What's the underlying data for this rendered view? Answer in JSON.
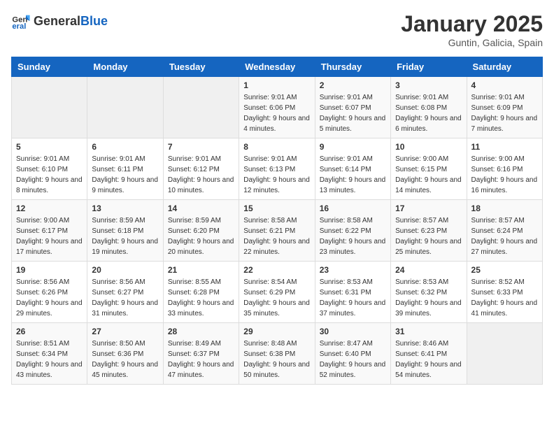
{
  "header": {
    "logo_general": "General",
    "logo_blue": "Blue",
    "month": "January 2025",
    "location": "Guntin, Galicia, Spain"
  },
  "days_of_week": [
    "Sunday",
    "Monday",
    "Tuesday",
    "Wednesday",
    "Thursday",
    "Friday",
    "Saturday"
  ],
  "weeks": [
    [
      {
        "day": "",
        "info": ""
      },
      {
        "day": "",
        "info": ""
      },
      {
        "day": "",
        "info": ""
      },
      {
        "day": "1",
        "info": "Sunrise: 9:01 AM\nSunset: 6:06 PM\nDaylight: 9 hours and 4 minutes."
      },
      {
        "day": "2",
        "info": "Sunrise: 9:01 AM\nSunset: 6:07 PM\nDaylight: 9 hours and 5 minutes."
      },
      {
        "day": "3",
        "info": "Sunrise: 9:01 AM\nSunset: 6:08 PM\nDaylight: 9 hours and 6 minutes."
      },
      {
        "day": "4",
        "info": "Sunrise: 9:01 AM\nSunset: 6:09 PM\nDaylight: 9 hours and 7 minutes."
      }
    ],
    [
      {
        "day": "5",
        "info": "Sunrise: 9:01 AM\nSunset: 6:10 PM\nDaylight: 9 hours and 8 minutes."
      },
      {
        "day": "6",
        "info": "Sunrise: 9:01 AM\nSunset: 6:11 PM\nDaylight: 9 hours and 9 minutes."
      },
      {
        "day": "7",
        "info": "Sunrise: 9:01 AM\nSunset: 6:12 PM\nDaylight: 9 hours and 10 minutes."
      },
      {
        "day": "8",
        "info": "Sunrise: 9:01 AM\nSunset: 6:13 PM\nDaylight: 9 hours and 12 minutes."
      },
      {
        "day": "9",
        "info": "Sunrise: 9:01 AM\nSunset: 6:14 PM\nDaylight: 9 hours and 13 minutes."
      },
      {
        "day": "10",
        "info": "Sunrise: 9:00 AM\nSunset: 6:15 PM\nDaylight: 9 hours and 14 minutes."
      },
      {
        "day": "11",
        "info": "Sunrise: 9:00 AM\nSunset: 6:16 PM\nDaylight: 9 hours and 16 minutes."
      }
    ],
    [
      {
        "day": "12",
        "info": "Sunrise: 9:00 AM\nSunset: 6:17 PM\nDaylight: 9 hours and 17 minutes."
      },
      {
        "day": "13",
        "info": "Sunrise: 8:59 AM\nSunset: 6:18 PM\nDaylight: 9 hours and 19 minutes."
      },
      {
        "day": "14",
        "info": "Sunrise: 8:59 AM\nSunset: 6:20 PM\nDaylight: 9 hours and 20 minutes."
      },
      {
        "day": "15",
        "info": "Sunrise: 8:58 AM\nSunset: 6:21 PM\nDaylight: 9 hours and 22 minutes."
      },
      {
        "day": "16",
        "info": "Sunrise: 8:58 AM\nSunset: 6:22 PM\nDaylight: 9 hours and 23 minutes."
      },
      {
        "day": "17",
        "info": "Sunrise: 8:57 AM\nSunset: 6:23 PM\nDaylight: 9 hours and 25 minutes."
      },
      {
        "day": "18",
        "info": "Sunrise: 8:57 AM\nSunset: 6:24 PM\nDaylight: 9 hours and 27 minutes."
      }
    ],
    [
      {
        "day": "19",
        "info": "Sunrise: 8:56 AM\nSunset: 6:26 PM\nDaylight: 9 hours and 29 minutes."
      },
      {
        "day": "20",
        "info": "Sunrise: 8:56 AM\nSunset: 6:27 PM\nDaylight: 9 hours and 31 minutes."
      },
      {
        "day": "21",
        "info": "Sunrise: 8:55 AM\nSunset: 6:28 PM\nDaylight: 9 hours and 33 minutes."
      },
      {
        "day": "22",
        "info": "Sunrise: 8:54 AM\nSunset: 6:29 PM\nDaylight: 9 hours and 35 minutes."
      },
      {
        "day": "23",
        "info": "Sunrise: 8:53 AM\nSunset: 6:31 PM\nDaylight: 9 hours and 37 minutes."
      },
      {
        "day": "24",
        "info": "Sunrise: 8:53 AM\nSunset: 6:32 PM\nDaylight: 9 hours and 39 minutes."
      },
      {
        "day": "25",
        "info": "Sunrise: 8:52 AM\nSunset: 6:33 PM\nDaylight: 9 hours and 41 minutes."
      }
    ],
    [
      {
        "day": "26",
        "info": "Sunrise: 8:51 AM\nSunset: 6:34 PM\nDaylight: 9 hours and 43 minutes."
      },
      {
        "day": "27",
        "info": "Sunrise: 8:50 AM\nSunset: 6:36 PM\nDaylight: 9 hours and 45 minutes."
      },
      {
        "day": "28",
        "info": "Sunrise: 8:49 AM\nSunset: 6:37 PM\nDaylight: 9 hours and 47 minutes."
      },
      {
        "day": "29",
        "info": "Sunrise: 8:48 AM\nSunset: 6:38 PM\nDaylight: 9 hours and 50 minutes."
      },
      {
        "day": "30",
        "info": "Sunrise: 8:47 AM\nSunset: 6:40 PM\nDaylight: 9 hours and 52 minutes."
      },
      {
        "day": "31",
        "info": "Sunrise: 8:46 AM\nSunset: 6:41 PM\nDaylight: 9 hours and 54 minutes."
      },
      {
        "day": "",
        "info": ""
      }
    ]
  ]
}
